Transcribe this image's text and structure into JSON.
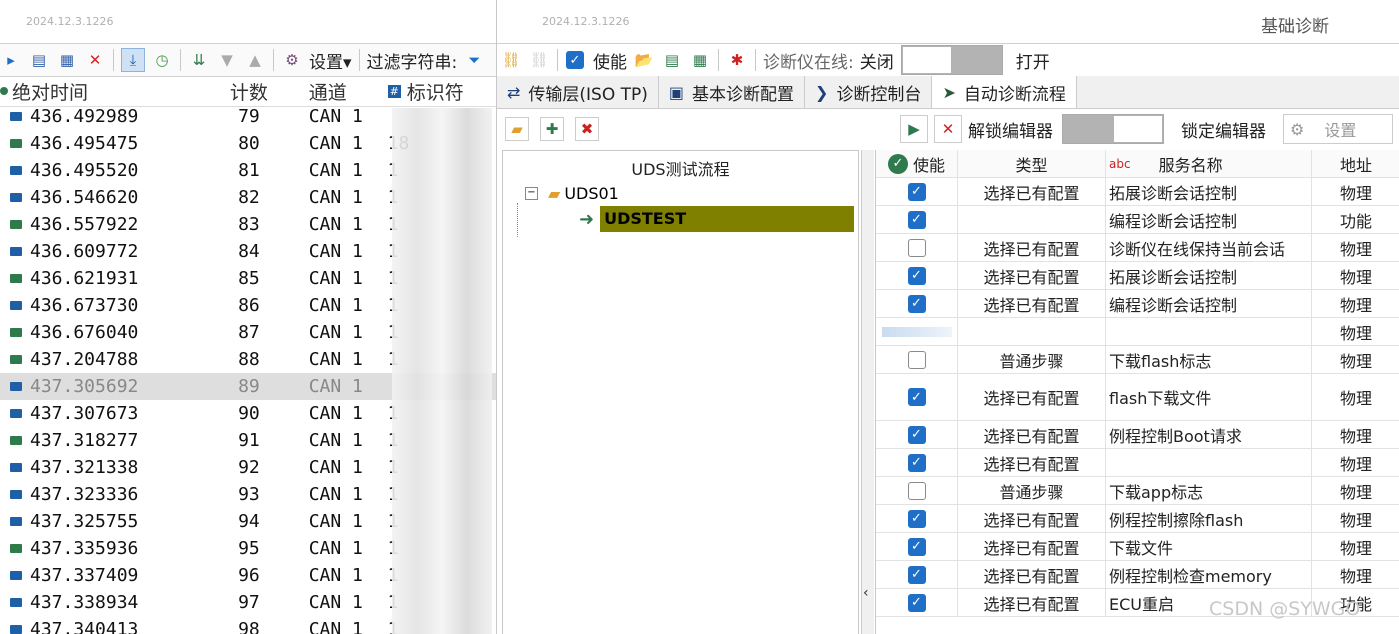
{
  "left": {
    "version": "2024.12.3.1226",
    "toolbar": {
      "settings": "设置▾",
      "filter_label": "过滤字符串:"
    },
    "columns": [
      "绝对时间",
      "计数",
      "通道",
      "标识符"
    ],
    "rows": [
      {
        "time": "436.492989",
        "count": "79",
        "chan": "CAN 1",
        "id": ""
      },
      {
        "time": "436.495475",
        "count": "80",
        "chan": "CAN 1",
        "id": "18"
      },
      {
        "time": "436.495520",
        "count": "81",
        "chan": "CAN 1",
        "id": "1"
      },
      {
        "time": "436.546620",
        "count": "82",
        "chan": "CAN 1",
        "id": "1"
      },
      {
        "time": "436.557922",
        "count": "83",
        "chan": "CAN 1",
        "id": "1"
      },
      {
        "time": "436.609772",
        "count": "84",
        "chan": "CAN 1",
        "id": "1"
      },
      {
        "time": "436.621931",
        "count": "85",
        "chan": "CAN 1",
        "id": "1"
      },
      {
        "time": "436.673730",
        "count": "86",
        "chan": "CAN 1",
        "id": "1"
      },
      {
        "time": "436.676040",
        "count": "87",
        "chan": "CAN 1",
        "id": "1"
      },
      {
        "time": "437.204788",
        "count": "88",
        "chan": "CAN 1",
        "id": "1"
      },
      {
        "time": "437.305692",
        "count": "89",
        "chan": "CAN 1",
        "id": ""
      },
      {
        "time": "437.307673",
        "count": "90",
        "chan": "CAN 1",
        "id": "1"
      },
      {
        "time": "437.318277",
        "count": "91",
        "chan": "CAN 1",
        "id": "1"
      },
      {
        "time": "437.321338",
        "count": "92",
        "chan": "CAN 1",
        "id": "1"
      },
      {
        "time": "437.323336",
        "count": "93",
        "chan": "CAN 1",
        "id": "1"
      },
      {
        "time": "437.325755",
        "count": "94",
        "chan": "CAN 1",
        "id": "1"
      },
      {
        "time": "437.335936",
        "count": "95",
        "chan": "CAN 1",
        "id": "1"
      },
      {
        "time": "437.337409",
        "count": "96",
        "chan": "CAN 1",
        "id": "1"
      },
      {
        "time": "437.338934",
        "count": "97",
        "chan": "CAN 1",
        "id": "1"
      },
      {
        "time": "437.340413",
        "count": "98",
        "chan": "CAN 1",
        "id": "1"
      }
    ]
  },
  "right": {
    "version": "2024.12.3.1226",
    "title": "基础诊断",
    "toolbar": {
      "enable": "使能",
      "online_label": "诊断仪在线:",
      "off": "关闭",
      "on": "打开"
    },
    "tabs": [
      "传输层(ISO TP)",
      "基本诊断配置",
      "诊断控制台",
      "自动诊断流程"
    ],
    "editor": {
      "unlock": "解锁编辑器",
      "lock": "锁定编辑器",
      "settings": "设置"
    },
    "tree": {
      "title": "UDS测试流程",
      "root": "UDS01",
      "child": "UDSTEST"
    },
    "grid": {
      "headers": [
        "使能",
        "类型",
        "abc",
        "服务名称",
        "地址"
      ],
      "rows": [
        {
          "checked": true,
          "type": "选择已有配置",
          "name": "拓展诊断会话控制",
          "addr": "物理"
        },
        {
          "checked": true,
          "type": "",
          "name": "编程诊断会话控制",
          "addr": "功能"
        },
        {
          "checked": false,
          "type": "选择已有配置",
          "name": "诊断仪在线保持当前会话",
          "addr": "物理"
        },
        {
          "checked": true,
          "type": "选择已有配置",
          "name": "拓展诊断会话控制",
          "addr": "物理"
        },
        {
          "checked": true,
          "type": "选择已有配置",
          "name": "编程诊断会话控制",
          "addr": "物理"
        },
        {
          "checked": null,
          "type": "",
          "name": "",
          "addr": "物理"
        },
        {
          "checked": false,
          "type": "普通步骤",
          "name": "下载flash标志",
          "addr": "物理"
        },
        {
          "checked": true,
          "type": "选择已有配置",
          "name": "flash下载文件",
          "addr": "物理",
          "tall": true
        },
        {
          "checked": true,
          "type": "选择已有配置",
          "name": "例程控制Boot请求",
          "addr": "物理"
        },
        {
          "checked": true,
          "type": "选择已有配置",
          "name": "",
          "addr": "物理"
        },
        {
          "checked": false,
          "type": "普通步骤",
          "name": "下载app标志",
          "addr": "物理"
        },
        {
          "checked": true,
          "type": "选择已有配置",
          "name": "例程控制擦除flash",
          "addr": "物理"
        },
        {
          "checked": true,
          "type": "选择已有配置",
          "name": "下载文件",
          "addr": "物理"
        },
        {
          "checked": true,
          "type": "选择已有配置",
          "name": "例程控制检查memory",
          "addr": "物理"
        },
        {
          "checked": true,
          "type": "选择已有配置",
          "name": "ECU重启",
          "addr": "功能"
        }
      ]
    },
    "watermark": "CSDN @SYWGO"
  },
  "colors": {
    "accent": "#1f6fc8",
    "tree_selected": "#808000",
    "msg_green": "#2f7a4d",
    "msg_blue": "#1f5fa8"
  }
}
